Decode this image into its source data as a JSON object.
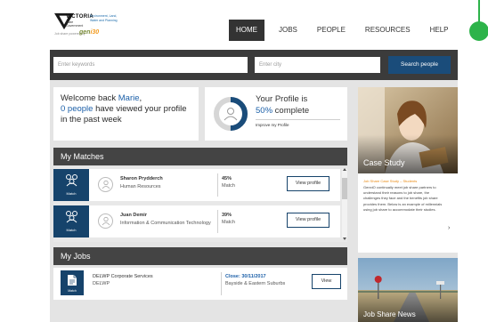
{
  "logo": {
    "state": "VICTORIA",
    "gov": "State Government",
    "dept": "Environment, Land, Water and Planning",
    "powered": "Job share powered by",
    "brand_a": "gen",
    "brand_b": "i30"
  },
  "nav": {
    "items": [
      "HOME",
      "JOBS",
      "PEOPLE",
      "RESOURCES",
      "HELP"
    ],
    "active": "HOME"
  },
  "search": {
    "keywords_placeholder": "Enter keywords",
    "city_placeholder": "Enter city",
    "button": "Search people"
  },
  "welcome": {
    "greeting": "Welcome back ",
    "name": "Marie",
    "comma": ",",
    "views": "0 people",
    "views_rest": " have viewed your profile",
    "period": "in the past week"
  },
  "profile": {
    "title": "Your Profile is",
    "percent": "50%",
    "status": " complete",
    "link": "Improve my Profile",
    "completion": 0.5
  },
  "matches": {
    "title": "My Matches",
    "badge_label": "Match",
    "view_label": "View profile",
    "rows": [
      {
        "name": "Sharon Prydderch",
        "role": "Human Resources",
        "pct": "45%",
        "pct_label": "Match"
      },
      {
        "name": "Juan Demir",
        "role": "Information & Communication Technology",
        "pct": "39%",
        "pct_label": "Match"
      }
    ]
  },
  "jobs": {
    "title": "My Jobs",
    "badge_label": "Match",
    "rows": [
      {
        "company": "DELWP Corporate Services",
        "dept": "DELWP",
        "close": "Close: 30/11/2017",
        "location": "Bayside & Eastern Suburbs",
        "view": "View"
      }
    ]
  },
  "case_study": {
    "title": "Case Study",
    "accent": "Job Share Case Study – Students",
    "text": "GenniO continually meet job share partners to understand their reasons to job share, the challenges they face and the benefits job share provides them. Below is an example of millennials using job share to accommodate their studies."
  },
  "news": {
    "title": "Job Share News"
  },
  "colors": {
    "accent": "#1b5fa8",
    "badge": "#16436b",
    "dark": "#3b3b3b",
    "green": "#2db34a",
    "orange": "#e98a13"
  }
}
